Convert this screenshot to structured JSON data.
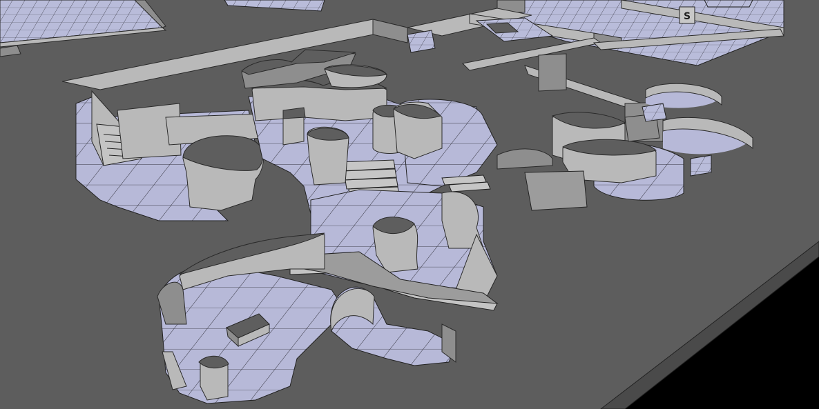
{
  "scene": {
    "colors": {
      "background": "#000000",
      "slab_top": "#5d5d5d",
      "floor_tint": "#b7b9d8",
      "wall": "#b9b9b9",
      "grid_line": "#2b2b34"
    },
    "markers": [
      {
        "label": "S"
      }
    ]
  }
}
